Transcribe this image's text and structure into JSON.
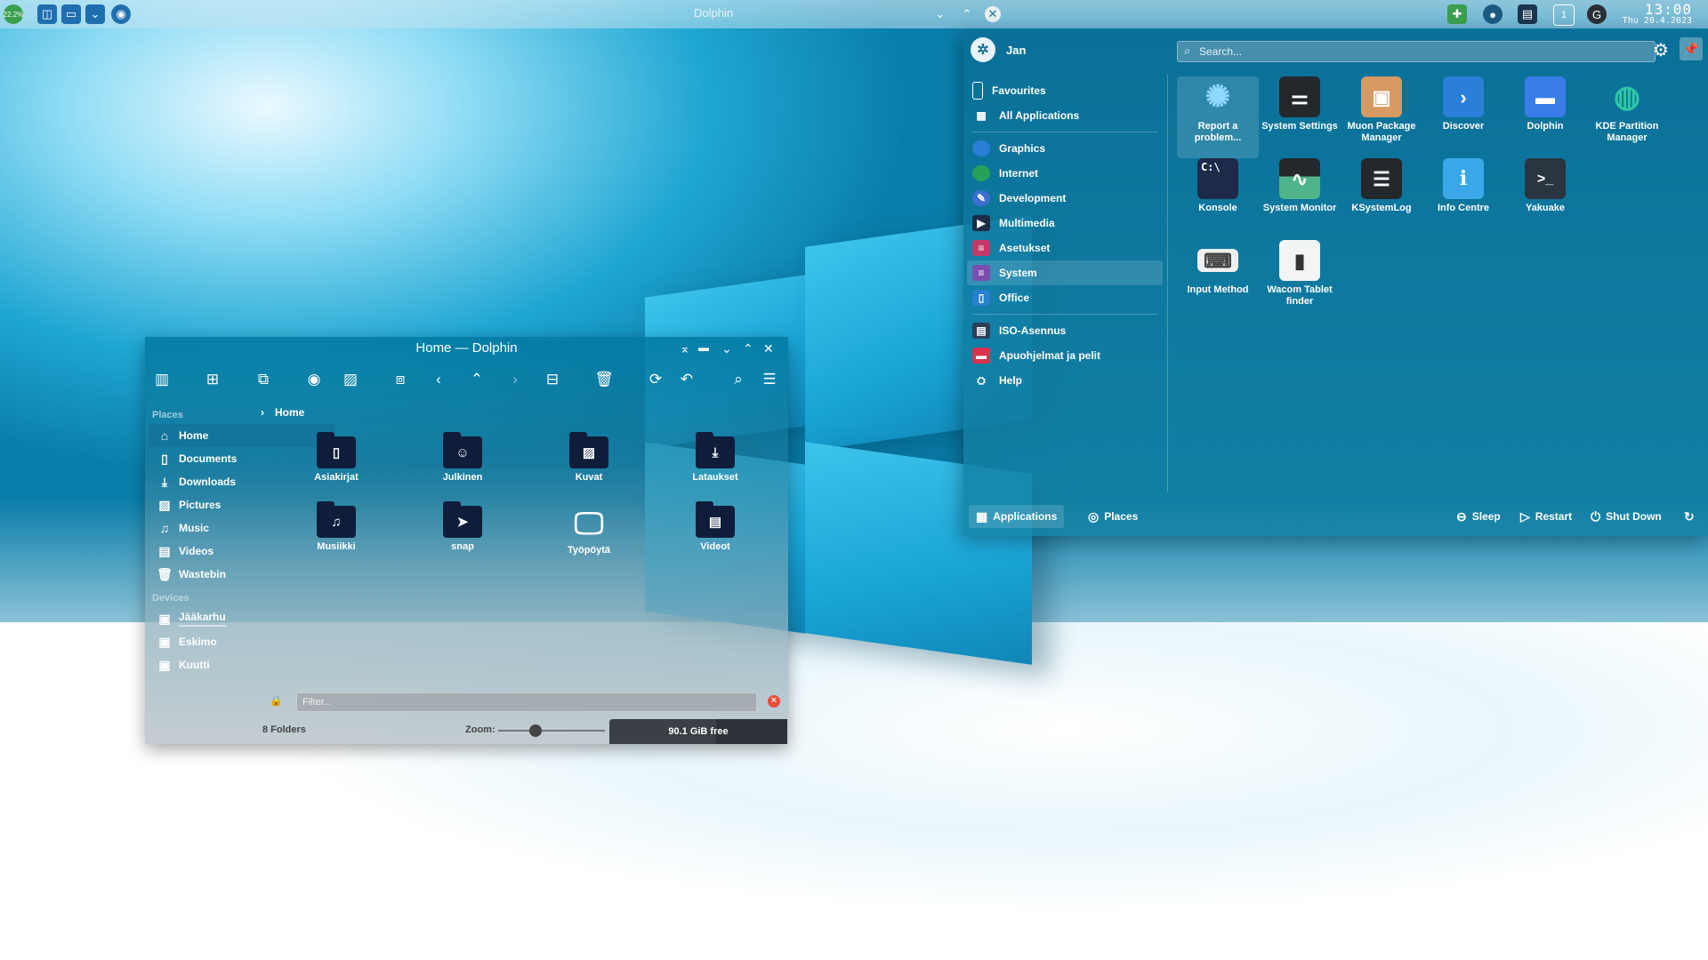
{
  "panel": {
    "battery": "22.2%",
    "window_title": "Dolphin",
    "clock_time": "13:00",
    "clock_date": "Thu 20.4.2023",
    "tray_badge": "1"
  },
  "dolphin": {
    "title": "Home — Dolphin",
    "places_header": "Places",
    "places": [
      {
        "label": "Home",
        "icon": "home-icon"
      },
      {
        "label": "Documents",
        "icon": "documents-icon"
      },
      {
        "label": "Downloads",
        "icon": "downloads-icon"
      },
      {
        "label": "Pictures",
        "icon": "pictures-icon"
      },
      {
        "label": "Music",
        "icon": "music-icon"
      },
      {
        "label": "Videos",
        "icon": "videos-icon"
      },
      {
        "label": "Wastebin",
        "icon": "trash-icon"
      }
    ],
    "devices_header": "Devices",
    "devices": [
      "Jääkarhu",
      "Eskimo",
      "Kuutti"
    ],
    "breadcrumb": "Home",
    "folders": [
      "Asiakirjat",
      "Julkinen",
      "Kuvat",
      "Lataukset",
      "Musiikki",
      "snap",
      "Työpöytä",
      "Videot"
    ],
    "filter_placeholder": "Filter...",
    "status": {
      "folders": "8 Folders",
      "zoom_label": "Zoom:",
      "free_space": "90.1 GiB free",
      "zoom_level": 0.35,
      "free_fraction": 0.6
    }
  },
  "menu": {
    "user": "Jan",
    "search_placeholder": "Search...",
    "categories_top": [
      "Favourites",
      "All Applications"
    ],
    "categories": [
      "Graphics",
      "Internet",
      "Development",
      "Multimedia",
      "Asetukset",
      "System",
      "Office"
    ],
    "categories_bottom": [
      "ISO-Asennus",
      "Apuohjelmat ja pelit",
      "Help"
    ],
    "selected_category": "System",
    "apps": [
      {
        "name": "Report a problem...",
        "icon": "bug-report-icon"
      },
      {
        "name": "System Settings",
        "icon": "settings-sliders-icon"
      },
      {
        "name": "Muon Package Manager",
        "icon": "package-box-icon"
      },
      {
        "name": "Discover",
        "icon": "discover-bag-icon"
      },
      {
        "name": "Dolphin",
        "icon": "folder-icon"
      },
      {
        "name": "KDE Partition Manager",
        "icon": "partition-ring-icon"
      },
      {
        "name": "Konsole",
        "icon": "terminal-icon"
      },
      {
        "name": "System Monitor",
        "icon": "monitor-graph-icon"
      },
      {
        "name": "KSystemLog",
        "icon": "log-viewer-icon"
      },
      {
        "name": "Info Centre",
        "icon": "info-icon"
      },
      {
        "name": "Yakuake",
        "icon": "dropdown-terminal-icon"
      },
      {
        "name": "Input Method",
        "icon": "keyboard-icon"
      },
      {
        "name": "Wacom Tablet finder",
        "icon": "tablet-icon"
      }
    ],
    "footer": {
      "applications": "Applications",
      "places": "Places",
      "sleep": "Sleep",
      "restart": "Restart",
      "shutdown": "Shut Down"
    }
  }
}
